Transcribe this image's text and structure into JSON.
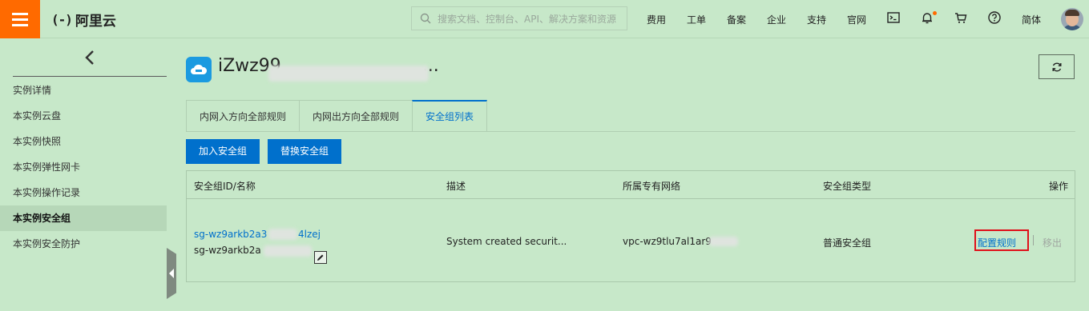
{
  "header": {
    "logo_mark": "(-)",
    "logo_text": "阿里云",
    "search_placeholder": "搜索文档、控制台、API、解决方案和资源",
    "nav": [
      "费用",
      "工单",
      "备案",
      "企业",
      "支持",
      "官网"
    ],
    "language": "简体",
    "icons": [
      "terminal-icon",
      "bell-icon",
      "cart-icon",
      "help-icon"
    ],
    "accent": "#ff6a00"
  },
  "sidebar": {
    "items": [
      {
        "label": "实例详情",
        "active": false
      },
      {
        "label": "本实例云盘",
        "active": false
      },
      {
        "label": "本实例快照",
        "active": false
      },
      {
        "label": "本实例弹性网卡",
        "active": false
      },
      {
        "label": "本实例操作记录",
        "active": false
      },
      {
        "label": "本实例安全组",
        "active": true
      },
      {
        "label": "本实例安全防护",
        "active": false
      }
    ]
  },
  "main": {
    "instance_title": "iZwz99",
    "tabs": [
      {
        "label": "内网入方向全部规则",
        "active": false
      },
      {
        "label": "内网出方向全部规则",
        "active": false
      },
      {
        "label": "安全组列表",
        "active": true
      }
    ],
    "buttons": {
      "join": "加入安全组",
      "replace": "替换安全组"
    },
    "table": {
      "columns": [
        "安全组ID/名称",
        "描述",
        "所属专有网络",
        "安全组类型",
        "操作"
      ],
      "rows": [
        {
          "id": "sg-wz9arkb2a3",
          "id_suffix": "4lzej",
          "name": "sg-wz9arkb2a",
          "description": "System created securit...",
          "vpc": "vpc-wz9tlu7al1ar9",
          "type": "普通安全组",
          "action_config": "配置规则",
          "action_remove": "移出"
        }
      ]
    }
  },
  "colors": {
    "primary": "#0070cc",
    "background": "#c7e8c9",
    "highlight": "#e0101a"
  }
}
